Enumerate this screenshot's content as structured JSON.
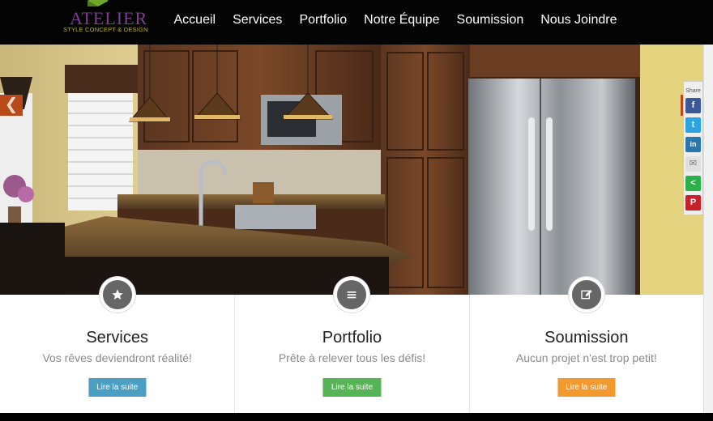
{
  "logo": {
    "name": "ATELIER",
    "tagline": "STYLE CONCEPT & DESIGN"
  },
  "nav": [
    "Accueil",
    "Services",
    "Portfolio",
    "Notre Équipe",
    "Soumission",
    "Nous Joindre"
  ],
  "slider": {
    "prev": "❮",
    "next": "❯"
  },
  "share": {
    "label": "Share",
    "buttons": [
      "f",
      "t",
      "in",
      "✉",
      "<",
      "P"
    ]
  },
  "features": [
    {
      "icon": "star-icon",
      "title": "Services",
      "text": "Vos rêves deviendront réalité!",
      "button": "Lire la suite",
      "color": "#4a9fc2"
    },
    {
      "icon": "list-icon",
      "title": "Portfolio",
      "text": "Prête à relever tous les défis!",
      "button": "Lire la suite",
      "color": "#56b356"
    },
    {
      "icon": "edit-icon",
      "title": "Soumission",
      "text": "Aucun projet n'est trop petit!",
      "button": "Lire la suite",
      "color": "#f29a2e"
    }
  ]
}
